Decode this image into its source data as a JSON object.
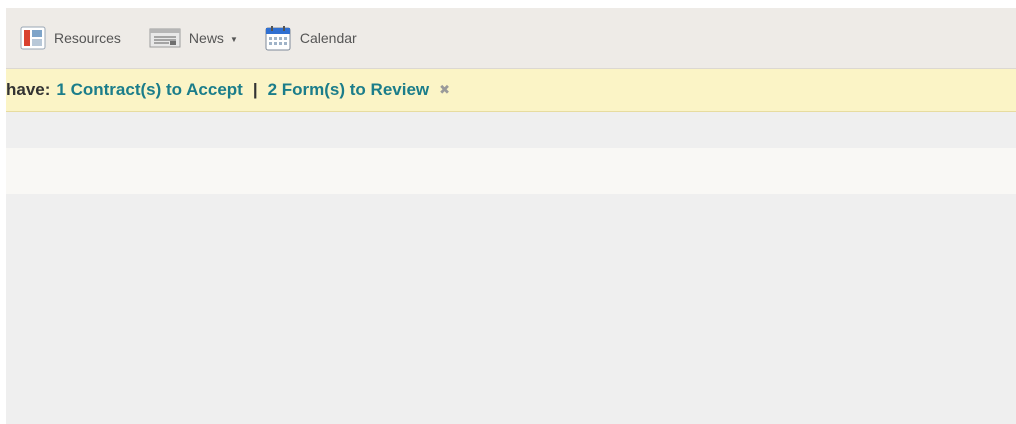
{
  "toolbar": {
    "items": [
      {
        "label": "Resources",
        "icon": "resources-icon"
      },
      {
        "label": "News",
        "icon": "news-icon",
        "has_dropdown": true
      },
      {
        "label": "Calendar",
        "icon": "calendar-icon"
      }
    ]
  },
  "banner": {
    "prefix": "have:",
    "link1": "1 Contract(s) to Accept",
    "separator": "|",
    "link2": "2 Form(s) to Review",
    "close_glyph": "✖"
  },
  "colors": {
    "toolbar_bg": "#eeebe7",
    "banner_bg": "#fbf4c6",
    "link": "#1b7d8a",
    "page_bg": "#efefef"
  }
}
